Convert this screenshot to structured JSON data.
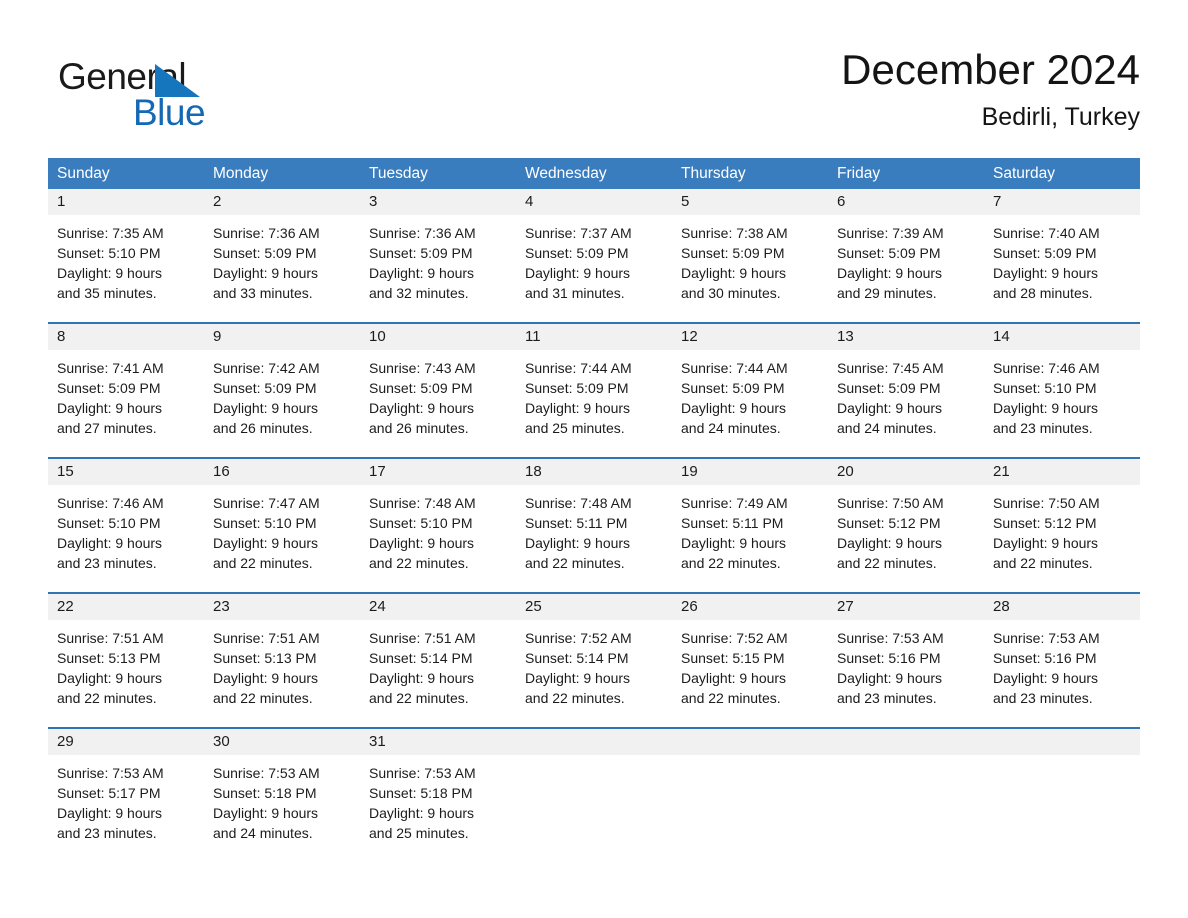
{
  "brand": {
    "name_part1": "General",
    "name_part2": "Blue",
    "triangle_color": "#1575bd",
    "accent_color": "#3a7dbf"
  },
  "header": {
    "title": "December 2024",
    "subtitle": "Bedirli, Turkey"
  },
  "weekdays": [
    "Sunday",
    "Monday",
    "Tuesday",
    "Wednesday",
    "Thursday",
    "Friday",
    "Saturday"
  ],
  "weeks": [
    {
      "days": [
        {
          "num": "1",
          "sunrise": "Sunrise: 7:35 AM",
          "sunset": "Sunset: 5:10 PM",
          "daylight1": "Daylight: 9 hours",
          "daylight2": "and 35 minutes."
        },
        {
          "num": "2",
          "sunrise": "Sunrise: 7:36 AM",
          "sunset": "Sunset: 5:09 PM",
          "daylight1": "Daylight: 9 hours",
          "daylight2": "and 33 minutes."
        },
        {
          "num": "3",
          "sunrise": "Sunrise: 7:36 AM",
          "sunset": "Sunset: 5:09 PM",
          "daylight1": "Daylight: 9 hours",
          "daylight2": "and 32 minutes."
        },
        {
          "num": "4",
          "sunrise": "Sunrise: 7:37 AM",
          "sunset": "Sunset: 5:09 PM",
          "daylight1": "Daylight: 9 hours",
          "daylight2": "and 31 minutes."
        },
        {
          "num": "5",
          "sunrise": "Sunrise: 7:38 AM",
          "sunset": "Sunset: 5:09 PM",
          "daylight1": "Daylight: 9 hours",
          "daylight2": "and 30 minutes."
        },
        {
          "num": "6",
          "sunrise": "Sunrise: 7:39 AM",
          "sunset": "Sunset: 5:09 PM",
          "daylight1": "Daylight: 9 hours",
          "daylight2": "and 29 minutes."
        },
        {
          "num": "7",
          "sunrise": "Sunrise: 7:40 AM",
          "sunset": "Sunset: 5:09 PM",
          "daylight1": "Daylight: 9 hours",
          "daylight2": "and 28 minutes."
        }
      ]
    },
    {
      "days": [
        {
          "num": "8",
          "sunrise": "Sunrise: 7:41 AM",
          "sunset": "Sunset: 5:09 PM",
          "daylight1": "Daylight: 9 hours",
          "daylight2": "and 27 minutes."
        },
        {
          "num": "9",
          "sunrise": "Sunrise: 7:42 AM",
          "sunset": "Sunset: 5:09 PM",
          "daylight1": "Daylight: 9 hours",
          "daylight2": "and 26 minutes."
        },
        {
          "num": "10",
          "sunrise": "Sunrise: 7:43 AM",
          "sunset": "Sunset: 5:09 PM",
          "daylight1": "Daylight: 9 hours",
          "daylight2": "and 26 minutes."
        },
        {
          "num": "11",
          "sunrise": "Sunrise: 7:44 AM",
          "sunset": "Sunset: 5:09 PM",
          "daylight1": "Daylight: 9 hours",
          "daylight2": "and 25 minutes."
        },
        {
          "num": "12",
          "sunrise": "Sunrise: 7:44 AM",
          "sunset": "Sunset: 5:09 PM",
          "daylight1": "Daylight: 9 hours",
          "daylight2": "and 24 minutes."
        },
        {
          "num": "13",
          "sunrise": "Sunrise: 7:45 AM",
          "sunset": "Sunset: 5:09 PM",
          "daylight1": "Daylight: 9 hours",
          "daylight2": "and 24 minutes."
        },
        {
          "num": "14",
          "sunrise": "Sunrise: 7:46 AM",
          "sunset": "Sunset: 5:10 PM",
          "daylight1": "Daylight: 9 hours",
          "daylight2": "and 23 minutes."
        }
      ]
    },
    {
      "days": [
        {
          "num": "15",
          "sunrise": "Sunrise: 7:46 AM",
          "sunset": "Sunset: 5:10 PM",
          "daylight1": "Daylight: 9 hours",
          "daylight2": "and 23 minutes."
        },
        {
          "num": "16",
          "sunrise": "Sunrise: 7:47 AM",
          "sunset": "Sunset: 5:10 PM",
          "daylight1": "Daylight: 9 hours",
          "daylight2": "and 22 minutes."
        },
        {
          "num": "17",
          "sunrise": "Sunrise: 7:48 AM",
          "sunset": "Sunset: 5:10 PM",
          "daylight1": "Daylight: 9 hours",
          "daylight2": "and 22 minutes."
        },
        {
          "num": "18",
          "sunrise": "Sunrise: 7:48 AM",
          "sunset": "Sunset: 5:11 PM",
          "daylight1": "Daylight: 9 hours",
          "daylight2": "and 22 minutes."
        },
        {
          "num": "19",
          "sunrise": "Sunrise: 7:49 AM",
          "sunset": "Sunset: 5:11 PM",
          "daylight1": "Daylight: 9 hours",
          "daylight2": "and 22 minutes."
        },
        {
          "num": "20",
          "sunrise": "Sunrise: 7:50 AM",
          "sunset": "Sunset: 5:12 PM",
          "daylight1": "Daylight: 9 hours",
          "daylight2": "and 22 minutes."
        },
        {
          "num": "21",
          "sunrise": "Sunrise: 7:50 AM",
          "sunset": "Sunset: 5:12 PM",
          "daylight1": "Daylight: 9 hours",
          "daylight2": "and 22 minutes."
        }
      ]
    },
    {
      "days": [
        {
          "num": "22",
          "sunrise": "Sunrise: 7:51 AM",
          "sunset": "Sunset: 5:13 PM",
          "daylight1": "Daylight: 9 hours",
          "daylight2": "and 22 minutes."
        },
        {
          "num": "23",
          "sunrise": "Sunrise: 7:51 AM",
          "sunset": "Sunset: 5:13 PM",
          "daylight1": "Daylight: 9 hours",
          "daylight2": "and 22 minutes."
        },
        {
          "num": "24",
          "sunrise": "Sunrise: 7:51 AM",
          "sunset": "Sunset: 5:14 PM",
          "daylight1": "Daylight: 9 hours",
          "daylight2": "and 22 minutes."
        },
        {
          "num": "25",
          "sunrise": "Sunrise: 7:52 AM",
          "sunset": "Sunset: 5:14 PM",
          "daylight1": "Daylight: 9 hours",
          "daylight2": "and 22 minutes."
        },
        {
          "num": "26",
          "sunrise": "Sunrise: 7:52 AM",
          "sunset": "Sunset: 5:15 PM",
          "daylight1": "Daylight: 9 hours",
          "daylight2": "and 22 minutes."
        },
        {
          "num": "27",
          "sunrise": "Sunrise: 7:53 AM",
          "sunset": "Sunset: 5:16 PM",
          "daylight1": "Daylight: 9 hours",
          "daylight2": "and 23 minutes."
        },
        {
          "num": "28",
          "sunrise": "Sunrise: 7:53 AM",
          "sunset": "Sunset: 5:16 PM",
          "daylight1": "Daylight: 9 hours",
          "daylight2": "and 23 minutes."
        }
      ]
    },
    {
      "days": [
        {
          "num": "29",
          "sunrise": "Sunrise: 7:53 AM",
          "sunset": "Sunset: 5:17 PM",
          "daylight1": "Daylight: 9 hours",
          "daylight2": "and 23 minutes."
        },
        {
          "num": "30",
          "sunrise": "Sunrise: 7:53 AM",
          "sunset": "Sunset: 5:18 PM",
          "daylight1": "Daylight: 9 hours",
          "daylight2": "and 24 minutes."
        },
        {
          "num": "31",
          "sunrise": "Sunrise: 7:53 AM",
          "sunset": "Sunset: 5:18 PM",
          "daylight1": "Daylight: 9 hours",
          "daylight2": "and 25 minutes."
        },
        {
          "num": "",
          "sunrise": "",
          "sunset": "",
          "daylight1": "",
          "daylight2": ""
        },
        {
          "num": "",
          "sunrise": "",
          "sunset": "",
          "daylight1": "",
          "daylight2": ""
        },
        {
          "num": "",
          "sunrise": "",
          "sunset": "",
          "daylight1": "",
          "daylight2": ""
        },
        {
          "num": "",
          "sunrise": "",
          "sunset": "",
          "daylight1": "",
          "daylight2": ""
        }
      ]
    }
  ]
}
